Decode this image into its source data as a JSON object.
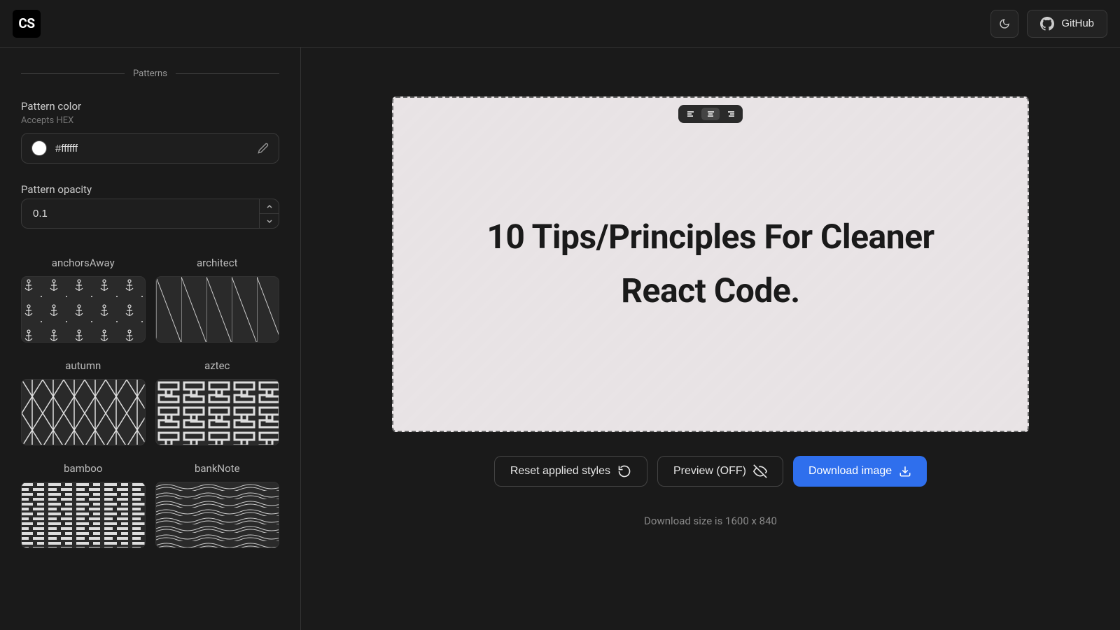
{
  "header": {
    "logo_text": "CS",
    "github_label": "GitHub"
  },
  "sidebar": {
    "section_title": "Patterns",
    "color": {
      "label": "Pattern color",
      "hint": "Accepts HEX",
      "value": "#ffffff",
      "swatch": "#ffffff"
    },
    "opacity": {
      "label": "Pattern opacity",
      "value": "0.1"
    },
    "patterns": [
      {
        "name": "anchorsAway"
      },
      {
        "name": "architect"
      },
      {
        "name": "autumn"
      },
      {
        "name": "aztec"
      },
      {
        "name": "bamboo"
      },
      {
        "name": "bankNote"
      }
    ]
  },
  "canvas": {
    "title": "10 Tips/Principles For Cleaner React Code.",
    "alignment": "center"
  },
  "actions": {
    "reset_label": "Reset applied styles",
    "preview_label": "Preview (OFF)",
    "download_label": "Download image"
  },
  "download_size_text": "Download size is 1600 x 840"
}
